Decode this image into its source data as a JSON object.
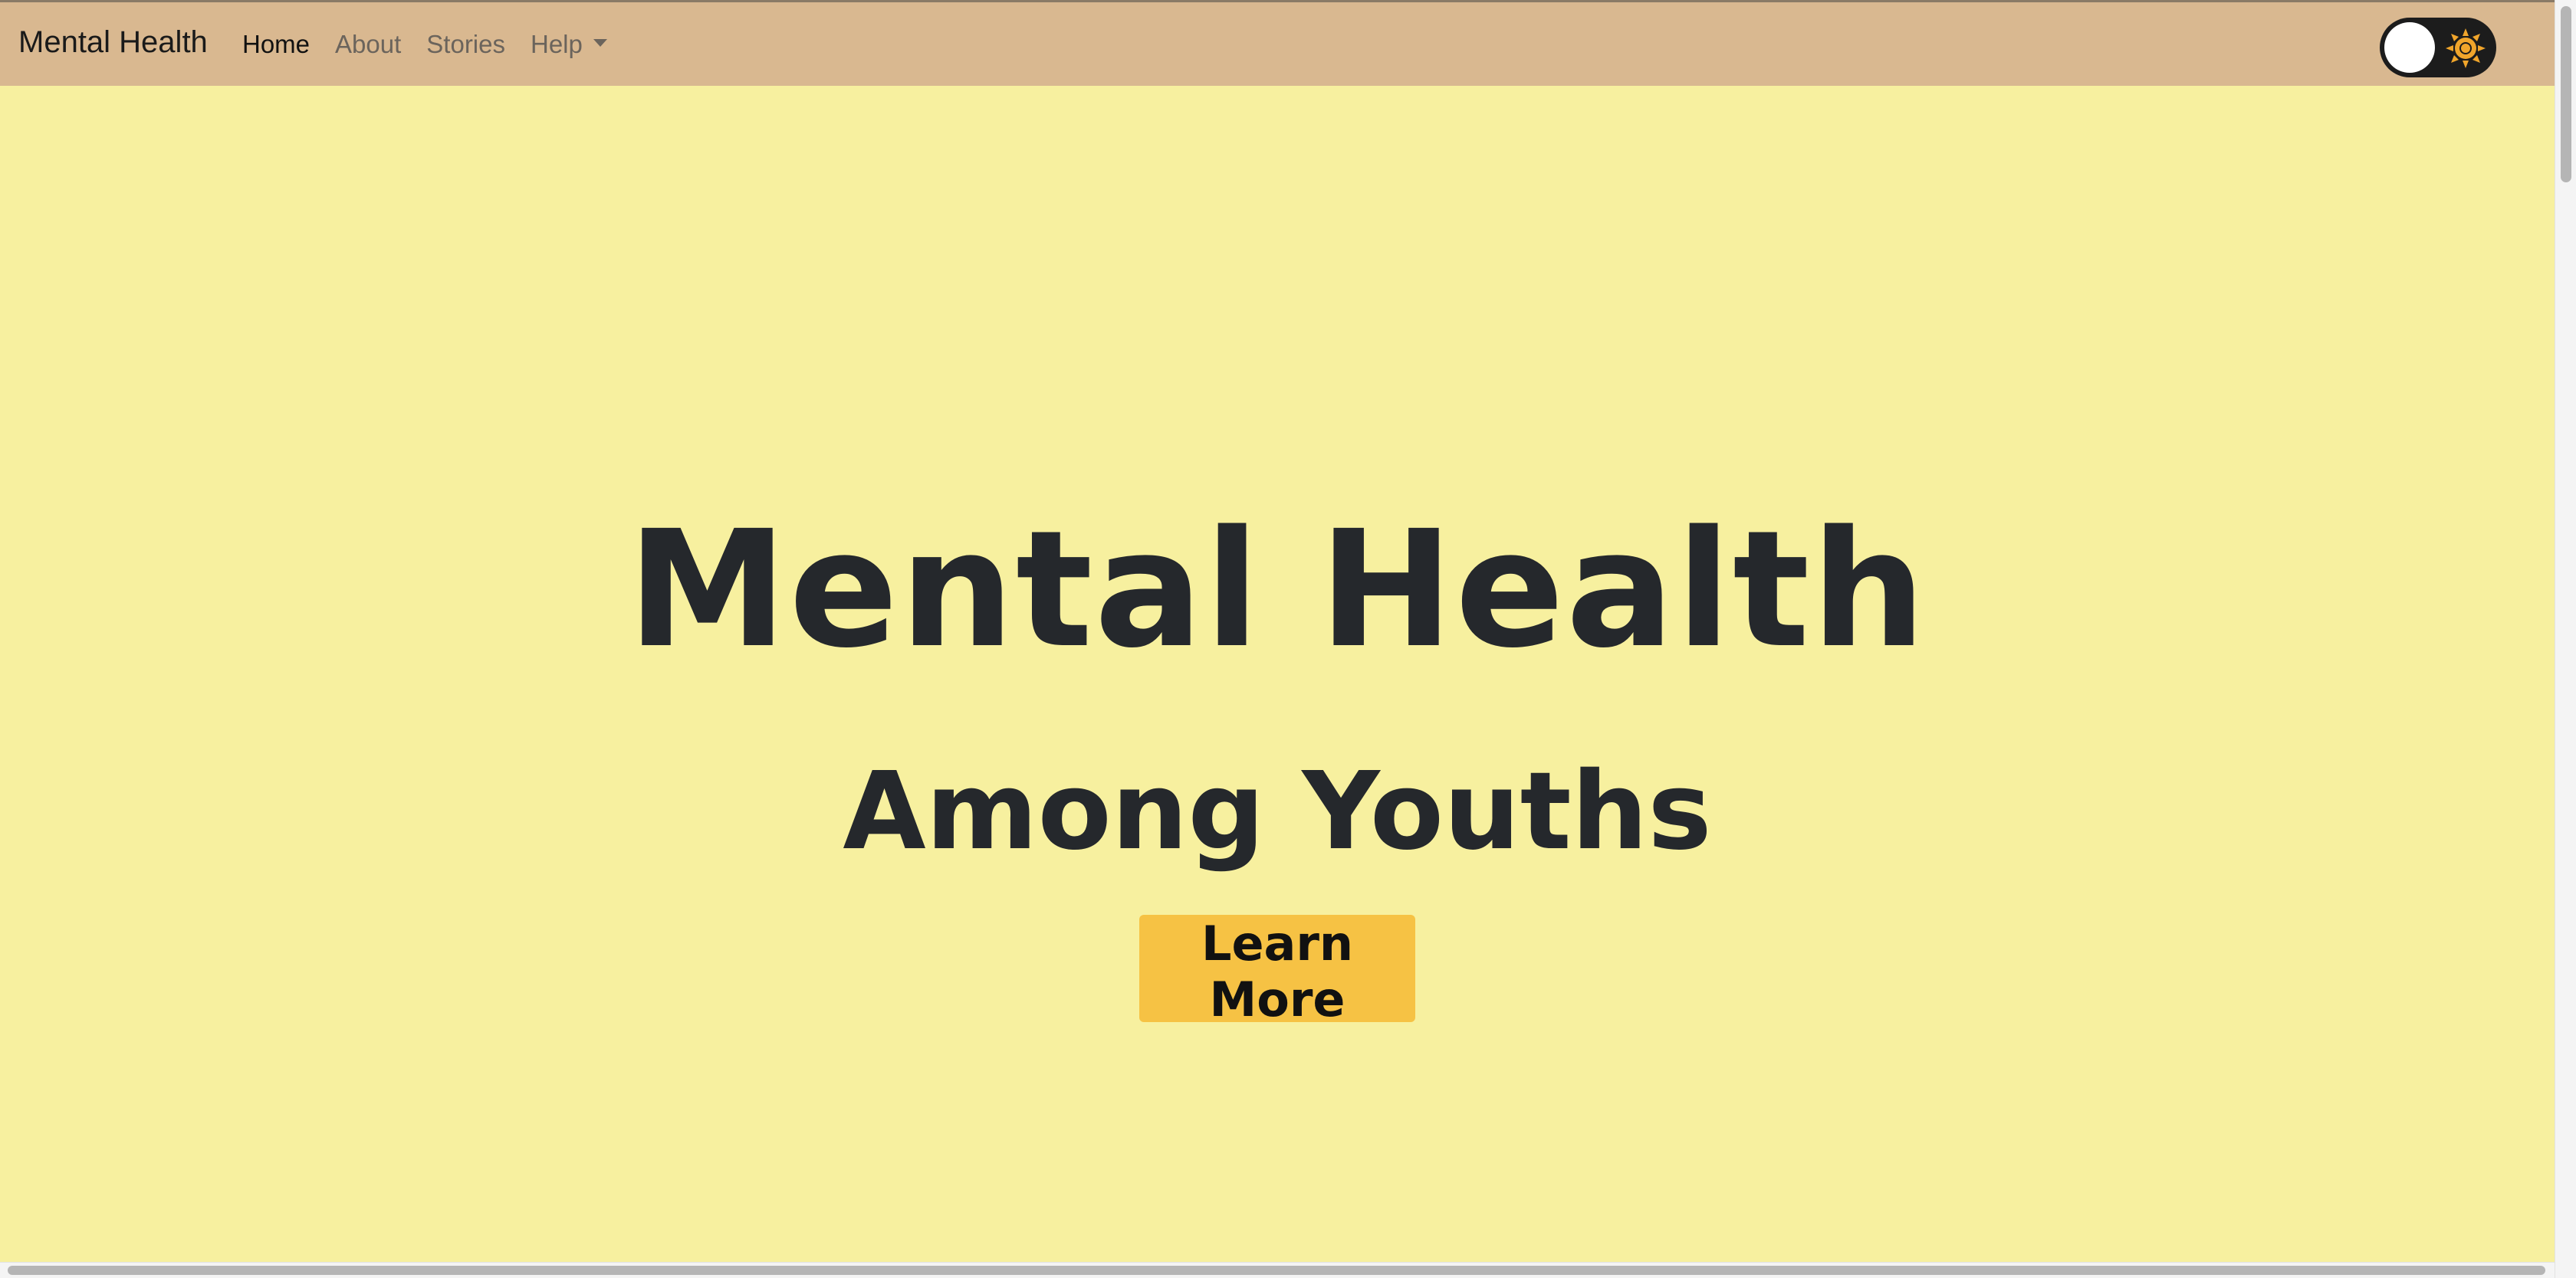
{
  "navbar": {
    "brand": "Mental Health",
    "links": [
      {
        "label": "Home",
        "active": true
      },
      {
        "label": "About",
        "active": false
      },
      {
        "label": "Stories",
        "active": false
      },
      {
        "label": "Help",
        "active": false,
        "dropdown": true
      }
    ],
    "theme_toggle": {
      "state": "light",
      "icon": "sun-icon"
    }
  },
  "hero": {
    "title": "Mental Health",
    "subtitle": "Among Youths",
    "cta_label": "Learn More"
  },
  "colors": {
    "navbar_bg": "#d9b890",
    "page_bg": "#f7f09f",
    "cta_bg": "#f6c244",
    "heading_text": "#25282c",
    "sun": "#f0a52b"
  }
}
